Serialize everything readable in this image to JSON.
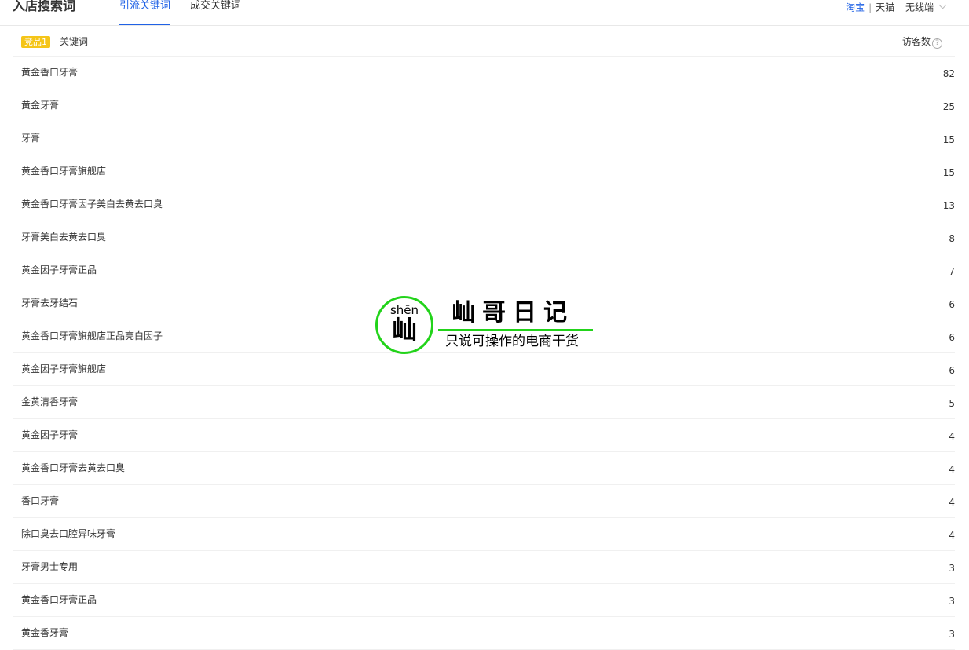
{
  "header": {
    "title": "入店搜索词",
    "tabs": [
      {
        "label": "引流关键词",
        "active": true
      },
      {
        "label": "成交关键词",
        "active": false
      }
    ],
    "platform": {
      "option_taobao": "淘宝",
      "separator": "|",
      "option_tmall": "天猫",
      "channel_selected": "无线端"
    }
  },
  "table": {
    "badge": "竞品1",
    "col_keyword": "关键词",
    "col_visitors": "访客数",
    "help_glyph": "?",
    "rows": [
      {
        "keyword": "黄金香口牙膏",
        "visitors": "82"
      },
      {
        "keyword": "黄金牙膏",
        "visitors": "25"
      },
      {
        "keyword": "牙膏",
        "visitors": "15"
      },
      {
        "keyword": "黄金香口牙膏旗舰店",
        "visitors": "15"
      },
      {
        "keyword": "黄金香口牙膏因子美白去黄去口臭",
        "visitors": "13"
      },
      {
        "keyword": "牙膏美白去黄去口臭",
        "visitors": "8"
      },
      {
        "keyword": "黄金因子牙膏正品",
        "visitors": "7"
      },
      {
        "keyword": "牙膏去牙结石",
        "visitors": "6"
      },
      {
        "keyword": "黄金香口牙膏旗舰店正品亮白因子",
        "visitors": "6"
      },
      {
        "keyword": "黄金因子牙膏旗舰店",
        "visitors": "6"
      },
      {
        "keyword": "金黄清香牙膏",
        "visitors": "5"
      },
      {
        "keyword": "黄金因子牙膏",
        "visitors": "4"
      },
      {
        "keyword": "黄金香口牙膏去黄去口臭",
        "visitors": "4"
      },
      {
        "keyword": "香口牙膏",
        "visitors": "4"
      },
      {
        "keyword": "除口臭去口腔异味牙膏",
        "visitors": "4"
      },
      {
        "keyword": "牙膏男士专用",
        "visitors": "3"
      },
      {
        "keyword": "黄金香口牙膏正品",
        "visitors": "3"
      },
      {
        "keyword": "黄金香牙膏",
        "visitors": "3"
      }
    ]
  },
  "watermark": {
    "pinyin": "shēn",
    "char": "屾",
    "title": "屾哥日记",
    "subtitle": "只说可操作的电商干货"
  },
  "colors": {
    "accent": "#2062e6",
    "badge": "#f5c518",
    "watermark_green": "#22d31a"
  }
}
